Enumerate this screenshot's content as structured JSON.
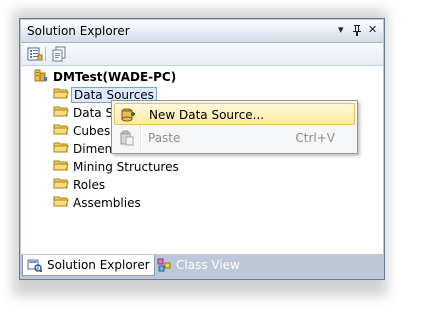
{
  "window": {
    "title": "Solution Explorer",
    "dropdown_icon": "▾",
    "pin_icon": "ㅍ",
    "close_icon": "✕"
  },
  "toolbar": {
    "items": [
      {
        "icon": "properties-icon"
      },
      {
        "icon": "show-all-files-icon"
      }
    ]
  },
  "tree": {
    "root": {
      "label": "DMTest(WADE-PC)",
      "icon": "project-icon"
    },
    "items": [
      {
        "label": "Data Sources",
        "icon": "folder-icon",
        "selected": true
      },
      {
        "label": "Data Source Views",
        "icon": "folder-icon"
      },
      {
        "label": "Cubes",
        "icon": "folder-icon"
      },
      {
        "label": "Dimensions",
        "icon": "folder-icon"
      },
      {
        "label": "Mining Structures",
        "icon": "folder-icon"
      },
      {
        "label": "Roles",
        "icon": "folder-icon"
      },
      {
        "label": "Assemblies",
        "icon": "folder-icon"
      }
    ]
  },
  "context_menu": {
    "items": [
      {
        "label": "New Data Source...",
        "shortcut": "",
        "icon": "new-data-source-icon",
        "highlighted": true,
        "enabled": true
      },
      {
        "label": "Paste",
        "shortcut": "Ctrl+V",
        "icon": "paste-icon",
        "highlighted": false,
        "enabled": false
      }
    ]
  },
  "tabs": [
    {
      "label": "Solution Explorer",
      "icon": "solution-explorer-icon",
      "active": true
    },
    {
      "label": "Class View",
      "icon": "class-view-icon",
      "active": false
    }
  ],
  "colors": {
    "selection": "#dcebfc",
    "menu_highlight": "#fde9a5",
    "frame": "#bcc7d8"
  }
}
